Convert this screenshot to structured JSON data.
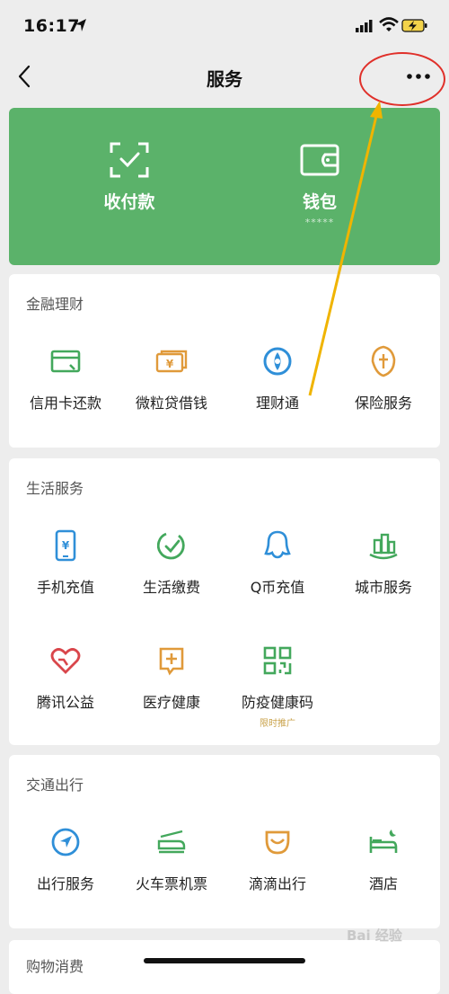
{
  "status": {
    "time": "16:17"
  },
  "nav": {
    "title": "服务"
  },
  "wallet": [
    {
      "label": "收付款",
      "sub": ""
    },
    {
      "label": "钱包",
      "sub": "*****"
    }
  ],
  "sections": [
    {
      "title": "金融理财",
      "items": [
        {
          "label": "信用卡还款",
          "icon": "credit-card-icon"
        },
        {
          "label": "微粒贷借钱",
          "icon": "loan-icon"
        },
        {
          "label": "理财通",
          "icon": "wealth-icon"
        },
        {
          "label": "保险服务",
          "icon": "insurance-icon"
        }
      ]
    },
    {
      "title": "生活服务",
      "items": [
        {
          "label": "手机充值",
          "icon": "phone-topup-icon"
        },
        {
          "label": "生活缴费",
          "icon": "utility-bill-icon"
        },
        {
          "label": "Q币充值",
          "icon": "qq-coin-icon"
        },
        {
          "label": "城市服务",
          "icon": "city-service-icon"
        },
        {
          "label": "腾讯公益",
          "icon": "charity-icon"
        },
        {
          "label": "医疗健康",
          "icon": "medical-icon"
        },
        {
          "label": "防疫健康码",
          "icon": "qr-code-icon",
          "tag": "限时推广"
        }
      ]
    },
    {
      "title": "交通出行",
      "items": [
        {
          "label": "出行服务",
          "icon": "travel-icon"
        },
        {
          "label": "火车票机票",
          "icon": "train-ticket-icon"
        },
        {
          "label": "滴滴出行",
          "icon": "didi-icon"
        },
        {
          "label": "酒店",
          "icon": "hotel-icon"
        }
      ]
    },
    {
      "title": "购物消费",
      "items": []
    }
  ],
  "watermark": "Bai 经验",
  "colors": {
    "green": "#5bb26a",
    "accent": "#f0b400",
    "highlight": "#e0302a"
  }
}
